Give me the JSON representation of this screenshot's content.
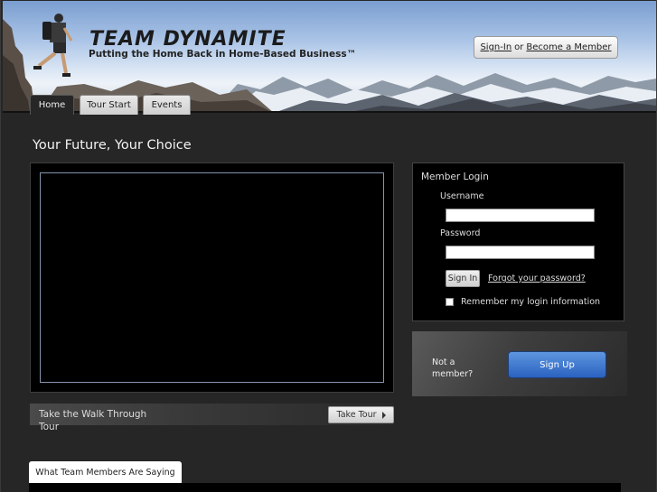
{
  "header": {
    "logo": "TEAM DYNAMITE",
    "tagline": "Putting the Home Back in Home-Based Business™",
    "signin_link": "Sign-In",
    "or_text": "or",
    "become_member_link": "Become a Member"
  },
  "tabs": [
    {
      "label": "Home",
      "active": true
    },
    {
      "label": "Tour Start",
      "active": false
    },
    {
      "label": "Events",
      "active": false
    }
  ],
  "page_title": "Your Future, Your Choice",
  "tour": {
    "text": "Take the Walk Through Tour",
    "button": "Take Tour"
  },
  "login": {
    "title": "Member Login",
    "username_label": "Username",
    "username_value": "",
    "password_label": "Password",
    "password_value": "",
    "signin_button": "Sign In",
    "forgot_link": "Forgot your password?",
    "remember_label": "Remember my login information"
  },
  "signup": {
    "text": "Not a member?",
    "button": "Sign Up"
  },
  "testimonials": {
    "tab_label": "What Team Members Are Saying"
  },
  "colors": {
    "background": "#262626",
    "signup_button": "#2a62c0"
  }
}
